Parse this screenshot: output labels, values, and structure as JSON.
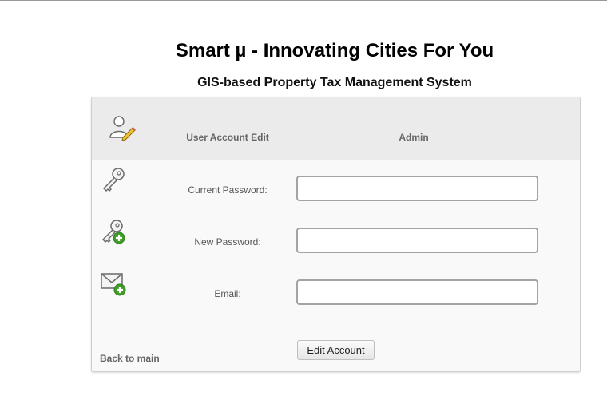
{
  "header": {
    "title": "Smart µ - Innovating Cities For You",
    "subtitle": "GIS-based Property Tax Management System"
  },
  "panel": {
    "heading": "User Account Edit",
    "username": "Admin",
    "fields": [
      {
        "label": "Current Password:",
        "value": "",
        "icon": "key-icon"
      },
      {
        "label": "New Password:",
        "value": "",
        "icon": "key-add-icon"
      },
      {
        "label": "Email:",
        "value": "",
        "icon": "mail-add-icon"
      }
    ],
    "submit_label": "Edit Account",
    "back_label": "Back to main"
  },
  "icons": {
    "header": "user-edit-icon"
  },
  "colors": {
    "panel_header_bg": "#ebebeb",
    "panel_bg": "#f9f9f9",
    "add_badge": "#3f9f26"
  }
}
